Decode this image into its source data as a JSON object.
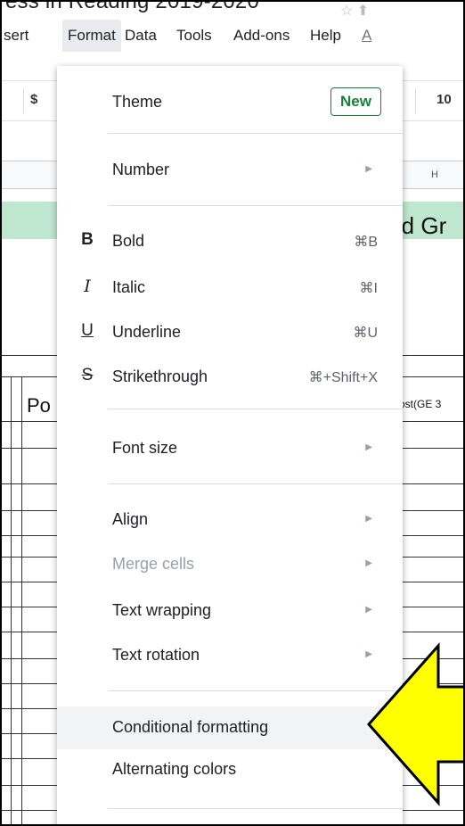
{
  "title": "ess in Reading 2019-2020",
  "menubar": {
    "insert": "sert",
    "format": "Format",
    "data": "Data",
    "tools": "Tools",
    "addons": "Add-ons",
    "help": "Help",
    "last": "A"
  },
  "toolbar": {
    "currency": "$",
    "font_size": "10"
  },
  "sheet": {
    "col_h": "H",
    "grade_text": "rd Gr",
    "po_text": "Po",
    "ost_text": "ost(GE 3"
  },
  "menu": {
    "theme": {
      "label": "Theme",
      "badge": "New"
    },
    "number": {
      "label": "Number"
    },
    "bold": {
      "label": "Bold",
      "shortcut": "⌘B",
      "icon": "B"
    },
    "italic": {
      "label": "Italic",
      "shortcut": "⌘I",
      "icon": "I"
    },
    "underline": {
      "label": "Underline",
      "shortcut": "⌘U",
      "icon": "U"
    },
    "strikethrough": {
      "label": "Strikethrough",
      "shortcut": "⌘+Shift+X",
      "icon": "S"
    },
    "font_size": {
      "label": "Font size"
    },
    "align": {
      "label": "Align"
    },
    "merge_cells": {
      "label": "Merge cells"
    },
    "text_wrapping": {
      "label": "Text wrapping"
    },
    "text_rotation": {
      "label": "Text rotation"
    },
    "conditional_formatting": {
      "label": "Conditional formatting"
    },
    "alternating_colors": {
      "label": "Alternating colors"
    }
  },
  "colors": {
    "new_badge": "#188038",
    "highlight_arrow": "#ffff00",
    "green_band": "#bfe6cf"
  }
}
